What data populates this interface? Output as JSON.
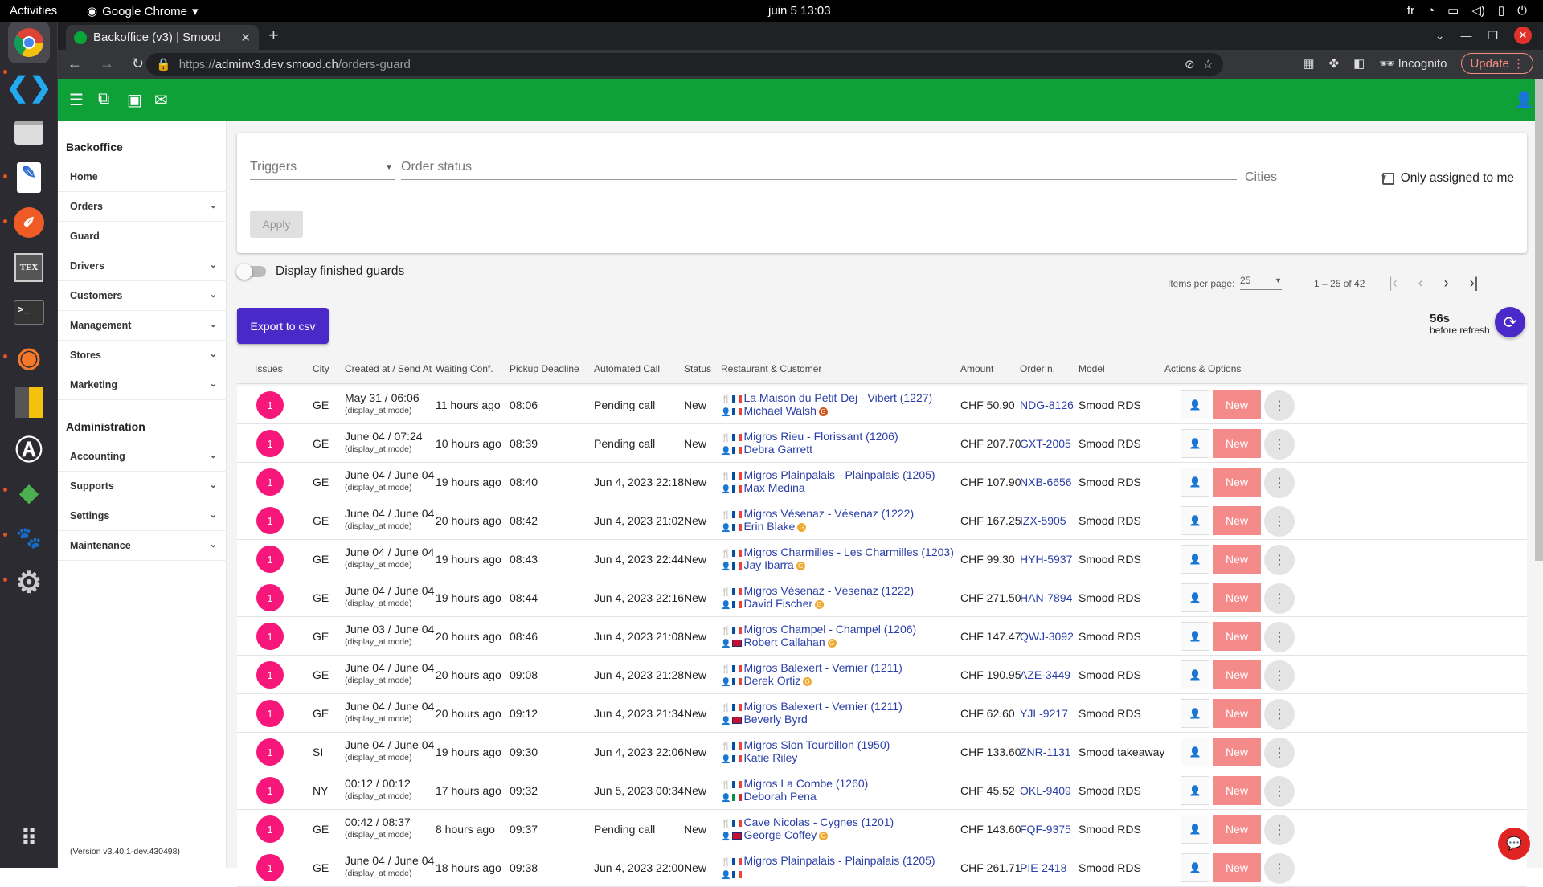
{
  "os": {
    "activities": "Activities",
    "app": "Google Chrome",
    "clock": "juin 5  13:03",
    "lang": "fr"
  },
  "dock": {
    "items": [
      "chrome-icon",
      "vscode-icon",
      "files-icon",
      "text-editor-icon",
      "postman-icon",
      "texmaker-icon",
      "terminal-icon",
      "blender-icon",
      "calculator-icon",
      "app-store-icon",
      "kolibri-icon",
      "gimp-icon",
      "settings-icon",
      "app-grid-icon"
    ]
  },
  "browser": {
    "tab_title": "Backoffice (v3) | Smood",
    "url_scheme": "https://",
    "url_host": "adminv3.dev.smood.ch",
    "url_path": "/orders-guard",
    "incognito": "Incognito",
    "update": "Update"
  },
  "sidebar": {
    "heading1": "Backoffice",
    "items1": [
      {
        "label": "Home",
        "chev": false
      },
      {
        "label": "Orders",
        "chev": true
      },
      {
        "label": "Guard",
        "chev": false
      },
      {
        "label": "Drivers",
        "chev": true
      },
      {
        "label": "Customers",
        "chev": true
      },
      {
        "label": "Management",
        "chev": true
      },
      {
        "label": "Stores",
        "chev": true
      },
      {
        "label": "Marketing",
        "chev": true
      }
    ],
    "heading2": "Administration",
    "items2": [
      {
        "label": "Accounting",
        "chev": true
      },
      {
        "label": "Supports",
        "chev": true
      },
      {
        "label": "Settings",
        "chev": true
      },
      {
        "label": "Maintenance",
        "chev": true
      }
    ],
    "version": "(Version v3.40.1-dev.430498)"
  },
  "filters": {
    "triggers": "Triggers",
    "order_status": "Order status",
    "cities": "Cities",
    "only_assigned": "Only assigned to me",
    "apply": "Apply",
    "display_finished": "Display finished guards"
  },
  "pager": {
    "items_per_page_label": "Items per page:",
    "items_per_page": "25",
    "range": "1 – 25 of 42"
  },
  "actions": {
    "export": "Export to csv",
    "refresh_count": "56s",
    "refresh_label": "before refresh"
  },
  "table": {
    "headers": [
      "Issues",
      "City",
      "Created at / Send At",
      "Waiting Conf.",
      "Pickup Deadline",
      "Automated Call",
      "Status",
      "Restaurant & Customer",
      "Amount",
      "Order n.",
      "Model",
      "Actions & Options"
    ],
    "rows": [
      {
        "issues": "1",
        "city": "GE",
        "created": "May 31 / 06:06",
        "mode": "(display_at mode)",
        "waiting": "11 hours ago",
        "pickup": "08:06",
        "call": "Pending call",
        "status": "New",
        "restaurant": "La Maison du Petit-Dej - Vibert (1227)",
        "customer": "Michael Walsh",
        "flag": "fr",
        "cbadge": "#d0541c",
        "amount": "CHF 50.90",
        "order": "NDG-8126",
        "model": "Smood RDS",
        "action": "New"
      },
      {
        "issues": "1",
        "city": "GE",
        "created": "June 04 / 07:24",
        "mode": "(display_at mode)",
        "waiting": "10 hours ago",
        "pickup": "08:39",
        "call": "Pending call",
        "status": "New",
        "restaurant": "Migros Rieu - Florissant (1206)",
        "customer": "Debra Garrett",
        "flag": "fr",
        "cbadge": "",
        "amount": "CHF 207.70",
        "order": "GXT-2005",
        "model": "Smood RDS",
        "action": "New"
      },
      {
        "issues": "1",
        "city": "GE",
        "created": "June 04 / June 04",
        "mode": "(display_at mode)",
        "waiting": "19 hours ago",
        "pickup": "08:40",
        "call": "Jun 4, 2023 22:18",
        "status": "New",
        "restaurant": "Migros Plainpalais - Plainpalais (1205)",
        "customer": "Max Medina",
        "flag": "fr",
        "cbadge": "",
        "amount": "CHF 107.90",
        "order": "NXB-6656",
        "model": "Smood RDS",
        "action": "New"
      },
      {
        "issues": "1",
        "city": "GE",
        "created": "June 04 / June 04",
        "mode": "(display_at mode)",
        "waiting": "20 hours ago",
        "pickup": "08:42",
        "call": "Jun 4, 2023 21:02",
        "status": "New",
        "restaurant": "Migros Vésenaz - Vésenaz (1222)",
        "customer": "Erin Blake",
        "flag": "fr",
        "cbadge": "#f0a830",
        "amount": "CHF 167.25",
        "order": "IZX-5905",
        "model": "Smood RDS",
        "action": "New"
      },
      {
        "issues": "1",
        "city": "GE",
        "created": "June 04 / June 04",
        "mode": "(display_at mode)",
        "waiting": "19 hours ago",
        "pickup": "08:43",
        "call": "Jun 4, 2023 22:44",
        "status": "New",
        "restaurant": "Migros Charmilles - Les Charmilles (1203)",
        "customer": "Jay Ibarra",
        "flag": "fr",
        "cbadge": "#f0a830",
        "amount": "CHF 99.30",
        "order": "HYH-5937",
        "model": "Smood RDS",
        "action": "New"
      },
      {
        "issues": "1",
        "city": "GE",
        "created": "June 04 / June 04",
        "mode": "(display_at mode)",
        "waiting": "19 hours ago",
        "pickup": "08:44",
        "call": "Jun 4, 2023 22:16",
        "status": "New",
        "restaurant": "Migros Vésenaz - Vésenaz (1222)",
        "customer": "David Fischer",
        "flag": "fr",
        "cbadge": "#f0a830",
        "amount": "CHF 271.50",
        "order": "HAN-7894",
        "model": "Smood RDS",
        "action": "New"
      },
      {
        "issues": "1",
        "city": "GE",
        "created": "June 03 / June 04",
        "mode": "(display_at mode)",
        "waiting": "20 hours ago",
        "pickup": "08:46",
        "call": "Jun 4, 2023 21:08",
        "status": "New",
        "restaurant": "Migros Champel - Champel (1206)",
        "customer": "Robert Callahan",
        "flag": "uk",
        "cbadge": "#f0a830",
        "amount": "CHF 147.47",
        "order": "QWJ-3092",
        "model": "Smood RDS",
        "action": "New"
      },
      {
        "issues": "1",
        "city": "GE",
        "created": "June 04 / June 04",
        "mode": "(display_at mode)",
        "waiting": "20 hours ago",
        "pickup": "09:08",
        "call": "Jun 4, 2023 21:28",
        "status": "New",
        "restaurant": "Migros Balexert - Vernier (1211)",
        "customer": "Derek Ortiz",
        "flag": "fr",
        "cbadge": "#f0a830",
        "amount": "CHF 190.95",
        "order": "AZE-3449",
        "model": "Smood RDS",
        "action": "New"
      },
      {
        "issues": "1",
        "city": "GE",
        "created": "June 04 / June 04",
        "mode": "(display_at mode)",
        "waiting": "20 hours ago",
        "pickup": "09:12",
        "call": "Jun 4, 2023 21:34",
        "status": "New",
        "restaurant": "Migros Balexert - Vernier (1211)",
        "customer": "Beverly Byrd",
        "flag": "uk",
        "cbadge": "",
        "amount": "CHF 62.60",
        "order": "YJL-9217",
        "model": "Smood RDS",
        "action": "New"
      },
      {
        "issues": "1",
        "city": "SI",
        "created": "June 04 / June 04",
        "mode": "(display_at mode)",
        "waiting": "19 hours ago",
        "pickup": "09:30",
        "call": "Jun 4, 2023 22:06",
        "status": "New",
        "restaurant": "Migros Sion Tourbillon (1950)",
        "customer": "Katie Riley",
        "flag": "fr",
        "cbadge": "",
        "amount": "CHF 133.60",
        "order": "ZNR-1131",
        "model": "Smood takeaway",
        "action": "New"
      },
      {
        "issues": "1",
        "city": "NY",
        "created": "00:12 / 00:12",
        "mode": "(display_at mode)",
        "waiting": "17 hours ago",
        "pickup": "09:32",
        "call": "Jun 5, 2023 00:34",
        "status": "New",
        "restaurant": "Migros La Combe (1260)",
        "customer": "Deborah Pena",
        "flag": "it",
        "cbadge": "",
        "amount": "CHF 45.52",
        "order": "OKL-9409",
        "model": "Smood RDS",
        "action": "New"
      },
      {
        "issues": "1",
        "city": "GE",
        "created": "00:42 / 08:37",
        "mode": "(display_at mode)",
        "waiting": "8 hours ago",
        "pickup": "09:37",
        "call": "Pending call",
        "status": "New",
        "restaurant": "Cave Nicolas - Cygnes (1201)",
        "customer": "George Coffey",
        "flag": "uk",
        "cbadge": "#f0a830",
        "amount": "CHF 143.60",
        "order": "FQF-9375",
        "model": "Smood RDS",
        "action": "New"
      },
      {
        "issues": "1",
        "city": "GE",
        "created": "June 04 / June 04",
        "mode": "(display_at mode)",
        "waiting": "18 hours ago",
        "pickup": "09:38",
        "call": "Jun 4, 2023 22:00",
        "status": "New",
        "restaurant": "Migros Plainpalais - Plainpalais (1205)",
        "customer": "",
        "flag": "fr",
        "cbadge": "",
        "amount": "CHF 261.71",
        "order": "PIE-2418",
        "model": "Smood RDS",
        "action": "New"
      }
    ]
  }
}
